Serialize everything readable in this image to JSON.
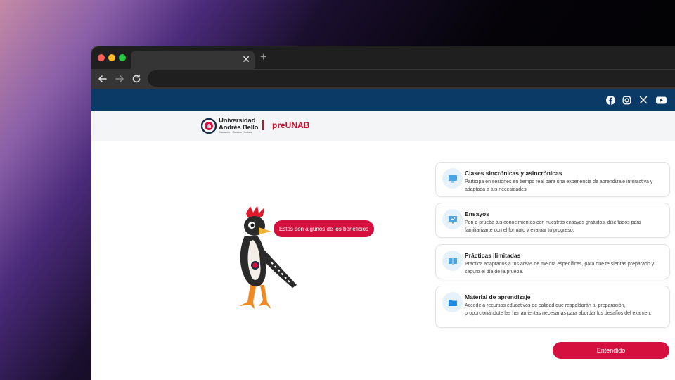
{
  "browser": {
    "tab_close": "✕",
    "new_tab": "+",
    "back_icon": "arrow-left-icon",
    "forward_icon": "arrow-right-icon",
    "reload_icon": "reload-icon"
  },
  "social": {
    "icons": [
      "facebook-icon",
      "instagram-icon",
      "x-icon",
      "youtube-icon"
    ],
    "bar_color": "#0b3a66"
  },
  "header": {
    "university_line1": "Universidad",
    "university_line2": "Andrés Bello",
    "university_tagline": "Educación · Ciencias · Cultura",
    "brand": "preUNAB",
    "brand_color": "#c8102e"
  },
  "mascot": {
    "bubble": "Estos son algunos de los beneficios"
  },
  "benefits": [
    {
      "title": "Clases sincrónicas y asincrónicas",
      "text": "Participa en sesiones en tiempo real para una experiencia de aprendizaje interactiva y adaptada a tus necesidades.",
      "icon": "monitor-icon"
    },
    {
      "title": "Ensayos",
      "text": "Pon a prueba tus conocimientos con nuestros ensayos gratuitos, diseñados para familiarizarte con el formato y evaluar tu progreso.",
      "icon": "presentation-icon"
    },
    {
      "title": "Prácticas ilimitadas",
      "text": "Practica adaptados a tus áreas de mejora específicas, para que te sientas preparado y seguro el día de la prueba.",
      "icon": "book-icon"
    },
    {
      "title": "Material de aprendizaje",
      "text": "Accede a recursos educativos de calidad que respaldarán tu preparación, proporcionándote las herramientas necesarias para abordar los desafíos del examen.",
      "icon": "folder-icon"
    }
  ],
  "cta": {
    "label": "Entendido",
    "color": "#d5103f"
  }
}
